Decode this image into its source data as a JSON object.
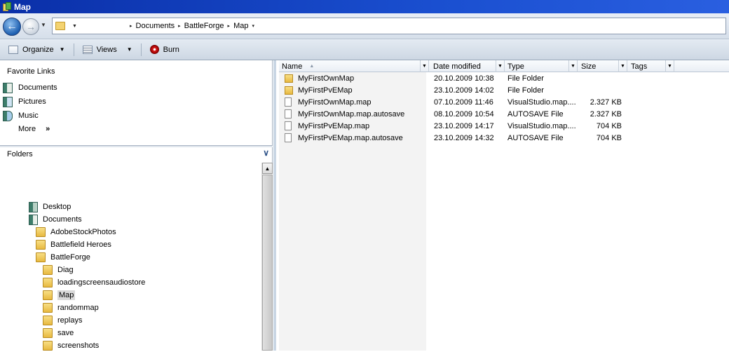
{
  "window": {
    "title": "Map"
  },
  "address": {
    "breadcrumbs": [
      "Documents",
      "BattleForge",
      "Map"
    ]
  },
  "toolbar": {
    "organize": "Organize",
    "views": "Views",
    "burn": "Burn"
  },
  "favorites": {
    "title": "Favorite Links",
    "items": [
      {
        "label": "Documents",
        "icon": "documents-icon"
      },
      {
        "label": "Pictures",
        "icon": "pictures-icon"
      },
      {
        "label": "Music",
        "icon": "music-icon"
      }
    ],
    "more": "More"
  },
  "folders": {
    "title": "Folders",
    "tree": [
      {
        "label": "Desktop",
        "icon": "desktop-icon"
      },
      {
        "label": "Documents",
        "icon": "documents-icon"
      },
      {
        "label": "AdobeStockPhotos",
        "icon": "folder-icon"
      },
      {
        "label": "Battlefield Heroes",
        "icon": "folder-icon"
      },
      {
        "label": "BattleForge",
        "icon": "folder-icon"
      },
      {
        "label": "Diag",
        "icon": "folder-icon"
      },
      {
        "label": "loadingscreensaudiostore",
        "icon": "folder-icon"
      },
      {
        "label": "Map",
        "icon": "folder-icon",
        "selected": true
      },
      {
        "label": "randommap",
        "icon": "folder-icon"
      },
      {
        "label": "replays",
        "icon": "folder-icon"
      },
      {
        "label": "save",
        "icon": "folder-icon"
      },
      {
        "label": "screenshots",
        "icon": "folder-icon"
      }
    ]
  },
  "columns": [
    "Name",
    "Date modified",
    "Type",
    "Size",
    "Tags"
  ],
  "files": [
    {
      "name": "MyFirstOwnMap",
      "date": "20.10.2009 10:38",
      "type": "File Folder",
      "size": "",
      "icon": "folder-icon"
    },
    {
      "name": "MyFirstPvEMap",
      "date": "23.10.2009 14:02",
      "type": "File Folder",
      "size": "",
      "icon": "folder-icon"
    },
    {
      "name": "MyFirstOwnMap.map",
      "date": "07.10.2009 11:46",
      "type": "VisualStudio.map....",
      "size": "2.327 KB",
      "icon": "file-icon"
    },
    {
      "name": "MyFirstOwnMap.map.autosave",
      "date": "08.10.2009 10:54",
      "type": "AUTOSAVE File",
      "size": "2.327 KB",
      "icon": "file-icon"
    },
    {
      "name": "MyFirstPvEMap.map",
      "date": "23.10.2009 14:17",
      "type": "VisualStudio.map....",
      "size": "704 KB",
      "icon": "file-icon"
    },
    {
      "name": "MyFirstPvEMap.map.autosave",
      "date": "23.10.2009 14:32",
      "type": "AUTOSAVE File",
      "size": "704 KB",
      "icon": "file-icon"
    }
  ]
}
